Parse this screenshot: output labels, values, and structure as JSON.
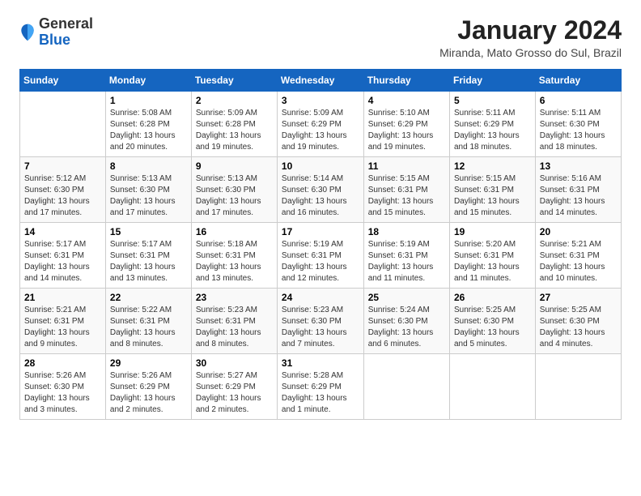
{
  "header": {
    "logo_general": "General",
    "logo_blue": "Blue",
    "month_title": "January 2024",
    "location": "Miranda, Mato Grosso do Sul, Brazil"
  },
  "days_of_week": [
    "Sunday",
    "Monday",
    "Tuesday",
    "Wednesday",
    "Thursday",
    "Friday",
    "Saturday"
  ],
  "weeks": [
    [
      {
        "day": "",
        "info": ""
      },
      {
        "day": "1",
        "info": "Sunrise: 5:08 AM\nSunset: 6:28 PM\nDaylight: 13 hours\nand 20 minutes."
      },
      {
        "day": "2",
        "info": "Sunrise: 5:09 AM\nSunset: 6:28 PM\nDaylight: 13 hours\nand 19 minutes."
      },
      {
        "day": "3",
        "info": "Sunrise: 5:09 AM\nSunset: 6:29 PM\nDaylight: 13 hours\nand 19 minutes."
      },
      {
        "day": "4",
        "info": "Sunrise: 5:10 AM\nSunset: 6:29 PM\nDaylight: 13 hours\nand 19 minutes."
      },
      {
        "day": "5",
        "info": "Sunrise: 5:11 AM\nSunset: 6:29 PM\nDaylight: 13 hours\nand 18 minutes."
      },
      {
        "day": "6",
        "info": "Sunrise: 5:11 AM\nSunset: 6:30 PM\nDaylight: 13 hours\nand 18 minutes."
      }
    ],
    [
      {
        "day": "7",
        "info": "Sunrise: 5:12 AM\nSunset: 6:30 PM\nDaylight: 13 hours\nand 17 minutes."
      },
      {
        "day": "8",
        "info": "Sunrise: 5:13 AM\nSunset: 6:30 PM\nDaylight: 13 hours\nand 17 minutes."
      },
      {
        "day": "9",
        "info": "Sunrise: 5:13 AM\nSunset: 6:30 PM\nDaylight: 13 hours\nand 17 minutes."
      },
      {
        "day": "10",
        "info": "Sunrise: 5:14 AM\nSunset: 6:30 PM\nDaylight: 13 hours\nand 16 minutes."
      },
      {
        "day": "11",
        "info": "Sunrise: 5:15 AM\nSunset: 6:31 PM\nDaylight: 13 hours\nand 15 minutes."
      },
      {
        "day": "12",
        "info": "Sunrise: 5:15 AM\nSunset: 6:31 PM\nDaylight: 13 hours\nand 15 minutes."
      },
      {
        "day": "13",
        "info": "Sunrise: 5:16 AM\nSunset: 6:31 PM\nDaylight: 13 hours\nand 14 minutes."
      }
    ],
    [
      {
        "day": "14",
        "info": "Sunrise: 5:17 AM\nSunset: 6:31 PM\nDaylight: 13 hours\nand 14 minutes."
      },
      {
        "day": "15",
        "info": "Sunrise: 5:17 AM\nSunset: 6:31 PM\nDaylight: 13 hours\nand 13 minutes."
      },
      {
        "day": "16",
        "info": "Sunrise: 5:18 AM\nSunset: 6:31 PM\nDaylight: 13 hours\nand 13 minutes."
      },
      {
        "day": "17",
        "info": "Sunrise: 5:19 AM\nSunset: 6:31 PM\nDaylight: 13 hours\nand 12 minutes."
      },
      {
        "day": "18",
        "info": "Sunrise: 5:19 AM\nSunset: 6:31 PM\nDaylight: 13 hours\nand 11 minutes."
      },
      {
        "day": "19",
        "info": "Sunrise: 5:20 AM\nSunset: 6:31 PM\nDaylight: 13 hours\nand 11 minutes."
      },
      {
        "day": "20",
        "info": "Sunrise: 5:21 AM\nSunset: 6:31 PM\nDaylight: 13 hours\nand 10 minutes."
      }
    ],
    [
      {
        "day": "21",
        "info": "Sunrise: 5:21 AM\nSunset: 6:31 PM\nDaylight: 13 hours\nand 9 minutes."
      },
      {
        "day": "22",
        "info": "Sunrise: 5:22 AM\nSunset: 6:31 PM\nDaylight: 13 hours\nand 8 minutes."
      },
      {
        "day": "23",
        "info": "Sunrise: 5:23 AM\nSunset: 6:31 PM\nDaylight: 13 hours\nand 8 minutes."
      },
      {
        "day": "24",
        "info": "Sunrise: 5:23 AM\nSunset: 6:30 PM\nDaylight: 13 hours\nand 7 minutes."
      },
      {
        "day": "25",
        "info": "Sunrise: 5:24 AM\nSunset: 6:30 PM\nDaylight: 13 hours\nand 6 minutes."
      },
      {
        "day": "26",
        "info": "Sunrise: 5:25 AM\nSunset: 6:30 PM\nDaylight: 13 hours\nand 5 minutes."
      },
      {
        "day": "27",
        "info": "Sunrise: 5:25 AM\nSunset: 6:30 PM\nDaylight: 13 hours\nand 4 minutes."
      }
    ],
    [
      {
        "day": "28",
        "info": "Sunrise: 5:26 AM\nSunset: 6:30 PM\nDaylight: 13 hours\nand 3 minutes."
      },
      {
        "day": "29",
        "info": "Sunrise: 5:26 AM\nSunset: 6:29 PM\nDaylight: 13 hours\nand 2 minutes."
      },
      {
        "day": "30",
        "info": "Sunrise: 5:27 AM\nSunset: 6:29 PM\nDaylight: 13 hours\nand 2 minutes."
      },
      {
        "day": "31",
        "info": "Sunrise: 5:28 AM\nSunset: 6:29 PM\nDaylight: 13 hours\nand 1 minute."
      },
      {
        "day": "",
        "info": ""
      },
      {
        "day": "",
        "info": ""
      },
      {
        "day": "",
        "info": ""
      }
    ]
  ]
}
